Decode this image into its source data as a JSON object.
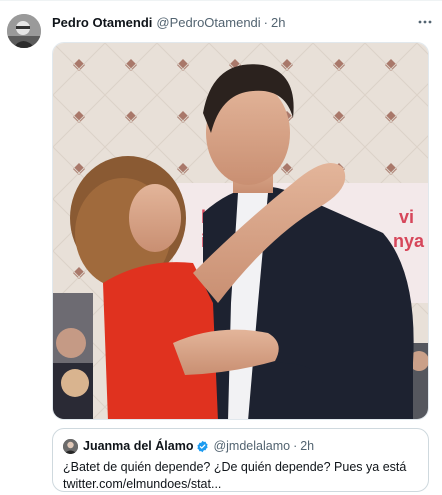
{
  "tweet": {
    "author_name": "Pedro Otamendi",
    "handle": "@PedroOtamendi",
    "separator": "·",
    "time": "2h",
    "avatar_icon": "user-avatar-photo",
    "more_icon": "more-horizontal-icon"
  },
  "media": {
    "banner_text_left": "ls f\ni d",
    "banner_text_right": "vi\nnya"
  },
  "quoted_tweet": {
    "author_name": "Juanma del Álamo",
    "verified_icon": "verified-badge-icon",
    "handle": "@jmdelalamo",
    "separator": "·",
    "time": "2h",
    "text_line1": "¿Batet de quién depende? ¿De quién depende? Pues ya está",
    "text_line2": "twitter.com/elmundoes/stat..."
  },
  "colors": {
    "verified": "#1d9bf0",
    "secondary_text": "#536471",
    "border": "#cfd9de"
  }
}
